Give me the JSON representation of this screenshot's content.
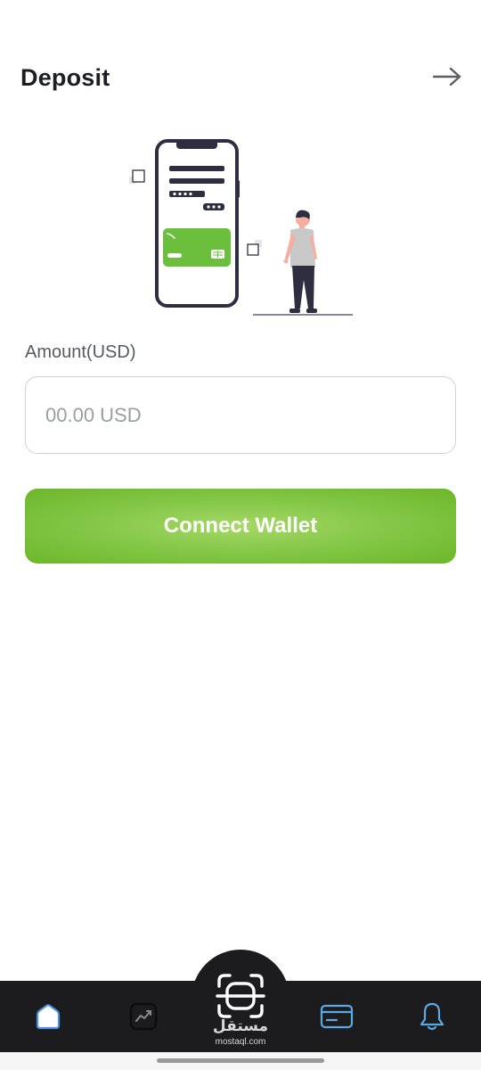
{
  "header": {
    "title": "Deposit",
    "forward_icon": "arrow-right-icon"
  },
  "illustration": {
    "name": "phone-payment-illustration",
    "accent_color": "#6cbf3c",
    "dark_color": "#2f2e41"
  },
  "form": {
    "amount_label": "Amount(USD)",
    "amount_placeholder": "00.00 USD",
    "amount_value": "",
    "submit_label": "Connect Wallet"
  },
  "bottom_nav": {
    "items": [
      {
        "name": "home",
        "icon": "home-icon",
        "active": true
      },
      {
        "name": "markets",
        "icon": "chart-trend-icon",
        "active": false
      },
      {
        "name": "scan",
        "icon": "scan-icon",
        "active": false
      },
      {
        "name": "cards",
        "icon": "card-icon",
        "active": false
      },
      {
        "name": "notifications",
        "icon": "bell-icon",
        "active": false
      }
    ]
  },
  "watermark": {
    "arabic": "مستقل",
    "latin": "mostaql.com"
  },
  "colors": {
    "accent_green": "#7cc242",
    "nav_background": "#1c1c1e",
    "nav_icon_active": "#4a90e2",
    "nav_icon_card": "#5aa9e6"
  }
}
